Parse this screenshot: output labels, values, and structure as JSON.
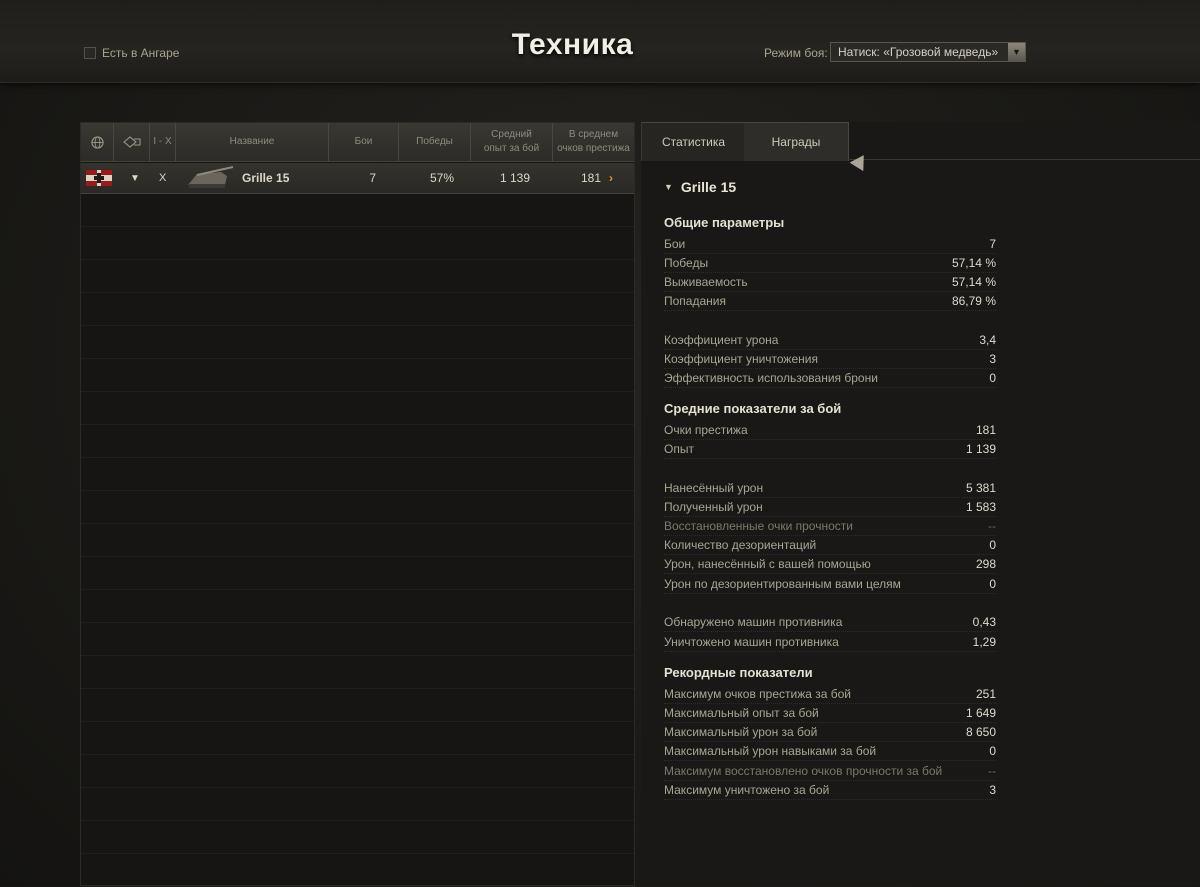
{
  "header": {
    "in_hangar_label": "Есть в Ангаре",
    "title": "Техника",
    "mode_label": "Режим боя:",
    "mode_value": "Натиск: «Грозовой медведь»"
  },
  "table": {
    "columns": {
      "name": "Название",
      "battles": "Бои",
      "wins": "Победы",
      "avg_xp_line1": "Средний",
      "avg_xp_line2": "опыт за бой",
      "avg_prestige_line1": "В среднем",
      "avg_prestige_line2": "очков престижа",
      "tier_filter": "I - X"
    },
    "rows": [
      {
        "nation": "germany",
        "tier": "X",
        "name": "Grille 15",
        "battles": "7",
        "wins": "57%",
        "avg_xp": "1 139",
        "avg_prestige": "181"
      }
    ]
  },
  "tabs": {
    "stats": "Статистика",
    "awards": "Награды"
  },
  "vehicle": "Grille 15",
  "sections": {
    "general": {
      "title": "Общие параметры",
      "rows": [
        {
          "label": "Бои",
          "value": "7"
        },
        {
          "label": "Победы",
          "value": "57,14 %"
        },
        {
          "label": "Выживаемость",
          "value": "57,14 %"
        },
        {
          "label": "Попадания",
          "value": "86,79 %"
        },
        {
          "label": "Коэффициент урона",
          "value": "3,4"
        },
        {
          "label": "Коэффициент уничтожения",
          "value": "3"
        },
        {
          "label": "Эффективность использования брони",
          "value": "0"
        }
      ]
    },
    "average": {
      "title": "Средние показатели за бой",
      "rows": [
        {
          "label": "Очки престижа",
          "value": "181"
        },
        {
          "label": "Опыт",
          "value": "1 139"
        },
        {
          "label": "Нанесённый урон",
          "value": "5 381"
        },
        {
          "label": "Полученный урон",
          "value": "1 583"
        },
        {
          "label": "Восстановленные очки прочности",
          "value": "--"
        },
        {
          "label": "Количество дезориентаций",
          "value": "0"
        },
        {
          "label": "Урон, нанесённый с вашей помощью",
          "value": "298"
        },
        {
          "label": "Урон по дезориентированным вами целям",
          "value": "0"
        },
        {
          "label": "Обнаружено машин противника",
          "value": "0,43"
        },
        {
          "label": "Уничтожено машин противника",
          "value": "1,29"
        }
      ]
    },
    "records": {
      "title": "Рекордные показатели",
      "rows": [
        {
          "label": "Максимум очков престижа за бой",
          "value": "251"
        },
        {
          "label": "Максимальный опыт за бой",
          "value": "1 649"
        },
        {
          "label": "Максимальный урон за бой",
          "value": "8 650"
        },
        {
          "label": "Максимальный урон навыками за бой",
          "value": "0"
        },
        {
          "label": "Максимум восстановлено очков прочности за бой",
          "value": "--"
        },
        {
          "label": "Максимум уничтожено за бой",
          "value": "3"
        }
      ]
    }
  }
}
